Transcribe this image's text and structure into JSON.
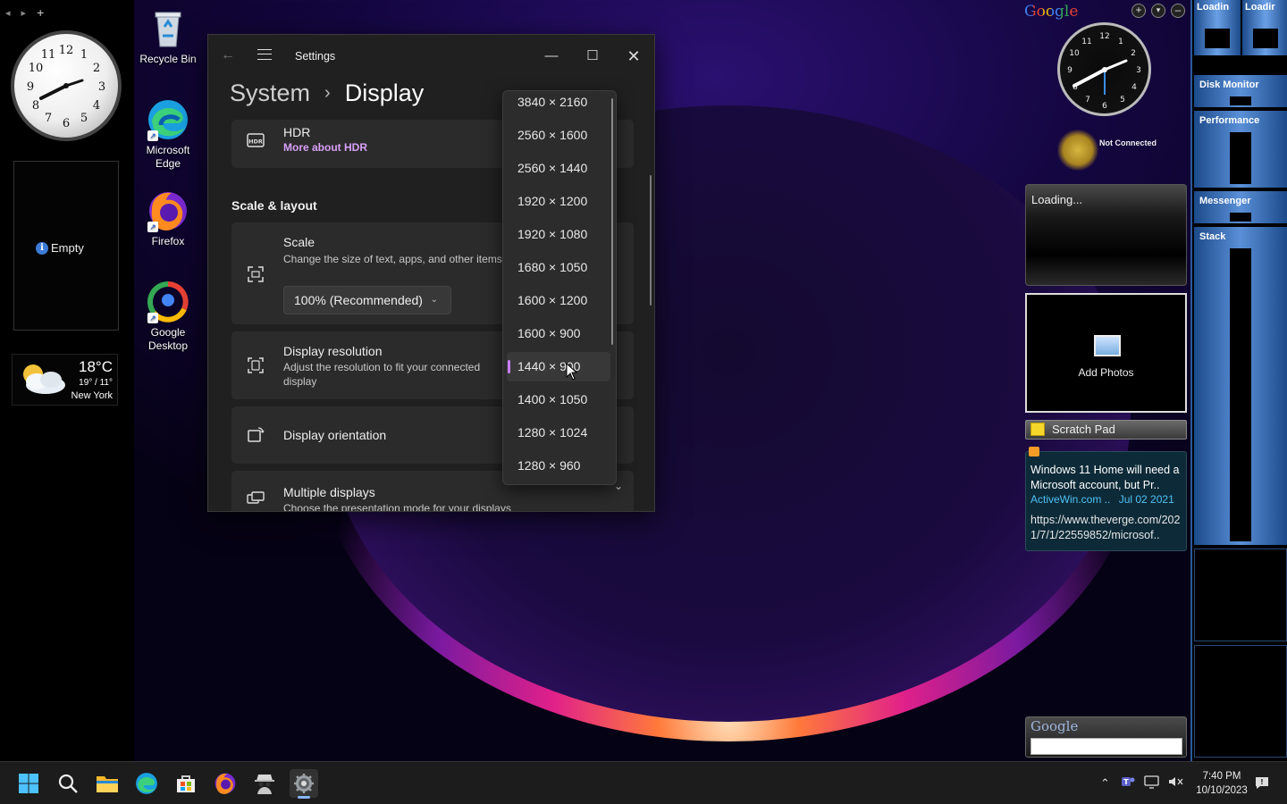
{
  "left_panel": {
    "nav_back": "◂",
    "nav_forward": "▸",
    "nav_add": "+",
    "empty_label": "Empty",
    "weather": {
      "temp": "18°C",
      "range": "19° / 11°",
      "city": "New York"
    }
  },
  "desktop_icons": [
    "Recycle Bin",
    "Microsoft Edge",
    "Firefox",
    "Google Desktop"
  ],
  "settings": {
    "window_title": "Settings",
    "breadcrumb_root": "System",
    "breadcrumb_sep": "›",
    "breadcrumb_current": "Display",
    "hdr": {
      "title": "HDR",
      "link": "More about HDR"
    },
    "section_title": "Scale & layout",
    "scale": {
      "title": "Scale",
      "subtitle": "Change the size of text, apps, and other items",
      "value": "100% (Recommended)"
    },
    "resolution": {
      "title": "Display resolution",
      "subtitle": "Adjust the resolution to fit your connected display"
    },
    "orientation": {
      "title": "Display orientation"
    },
    "multiple": {
      "title": "Multiple displays",
      "subtitle": "Choose the presentation mode for your displays"
    },
    "resolution_options": [
      "3840 × 2160",
      "2560 × 1600",
      "2560 × 1440",
      "1920 × 1200",
      "1920 × 1080",
      "1680 × 1050",
      "1600 × 1200",
      "1600 × 900",
      "1440 × 900",
      "1400 × 1050",
      "1280 × 1024",
      "1280 × 960"
    ],
    "selected_resolution": "1440 × 900"
  },
  "gadgets": {
    "google_logo": "Google",
    "not_connected": "Not Connected",
    "loading": "Loading...",
    "add_photos": "Add Photos",
    "scratch_pad": "Scratch Pad",
    "news": {
      "headline": "Windows 11 Home will need a Microsoft account, but Pr..",
      "source": "ActiveWin.com ..",
      "date": "Jul 02 2021",
      "url": "https://www.theverge.com/2021/7/1/22559852/microsof.."
    },
    "google_search_logo": "Google"
  },
  "sidebar_right": {
    "top_left": "Loadin",
    "top_right": "Loadir",
    "disk_monitor": "Disk Monitor",
    "performance": "Performance",
    "messenger": "Messenger",
    "stack": "Stack"
  },
  "taskbar": {
    "apps": [
      "start-icon",
      "search-icon",
      "file-explorer-icon",
      "edge-icon",
      "store-icon",
      "firefox-icon",
      "spy-icon",
      "settings-icon"
    ],
    "time": "7:40 PM",
    "date": "10/10/2023"
  }
}
